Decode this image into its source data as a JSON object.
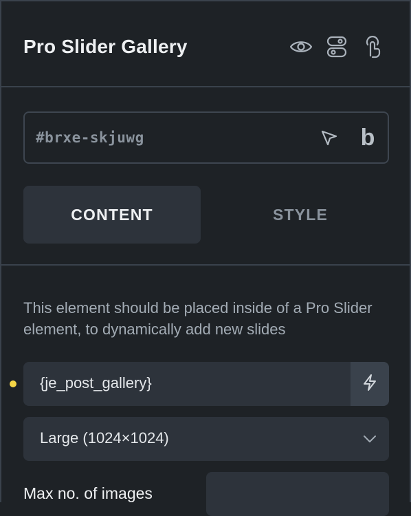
{
  "header": {
    "title": "Pro Slider Gallery",
    "icons": [
      "eye-icon",
      "toggle-icon",
      "touch-icon"
    ]
  },
  "element_id": {
    "value": "#brxe-skjuwg",
    "icons": [
      "cursor-icon",
      "bricks-b-icon"
    ],
    "b_glyph": "b"
  },
  "tabs": {
    "content_label": "CONTENT",
    "style_label": "STYLE",
    "active": "CONTENT"
  },
  "description": "This element should be placed inside of a Pro Slider element, to dynamically add new slides",
  "gallery": {
    "value": "{je_post_gallery}",
    "indicator_color": "#f5d546",
    "dynamic_icon": "lightning-icon"
  },
  "image_size": {
    "selected": "Large (1024×1024)"
  },
  "max_images": {
    "label": "Max no. of images",
    "value": ""
  },
  "colors": {
    "background": "#1e2226",
    "field": "#2d333b",
    "border": "#3a424c",
    "accent_dot": "#f5d546"
  }
}
